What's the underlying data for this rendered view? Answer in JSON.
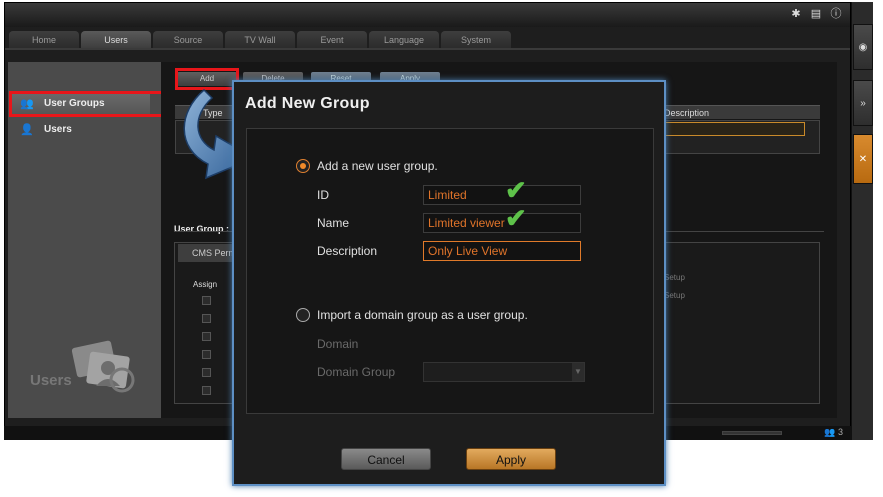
{
  "topbar": {
    "icons": [
      "gear-icon",
      "document-icon",
      "info-icon"
    ]
  },
  "tabs": [
    {
      "label": "Home"
    },
    {
      "label": "Users"
    },
    {
      "label": "Source"
    },
    {
      "label": "TV Wall"
    },
    {
      "label": "Event"
    },
    {
      "label": "Language"
    },
    {
      "label": "System"
    }
  ],
  "sidebar": {
    "items": [
      {
        "label": "User Groups"
      },
      {
        "label": "Users"
      }
    ],
    "caption": "Users"
  },
  "toolbar": {
    "add_label": "Add",
    "delete_label": "Delete",
    "reset_label": "Reset",
    "apply_label": "Apply"
  },
  "table": {
    "type_header": "Type",
    "description_header": "Description"
  },
  "user_group": {
    "title": "User Group :",
    "cms_tab": "CMS Perm",
    "assign_header": "Assign",
    "setup_items": [
      "Setup",
      "Setup"
    ]
  },
  "status": {
    "count": "3"
  },
  "modal": {
    "title": "Add New Group",
    "option_new": "Add a new user group.",
    "id_label": "ID",
    "id_value": "Limited",
    "name_label": "Name",
    "name_value": "Limited viewer",
    "description_label": "Description",
    "description_value": "Only Live View",
    "option_import": "Import a domain group as a user group.",
    "domain_label": "Domain",
    "domain_group_label": "Domain Group",
    "cancel_label": "Cancel",
    "apply_label": "Apply"
  },
  "colors": {
    "accent": "#e08030",
    "highlight_box": "#e8161a",
    "modal_border": "#5d8fc4",
    "check": "#5ec24a"
  }
}
